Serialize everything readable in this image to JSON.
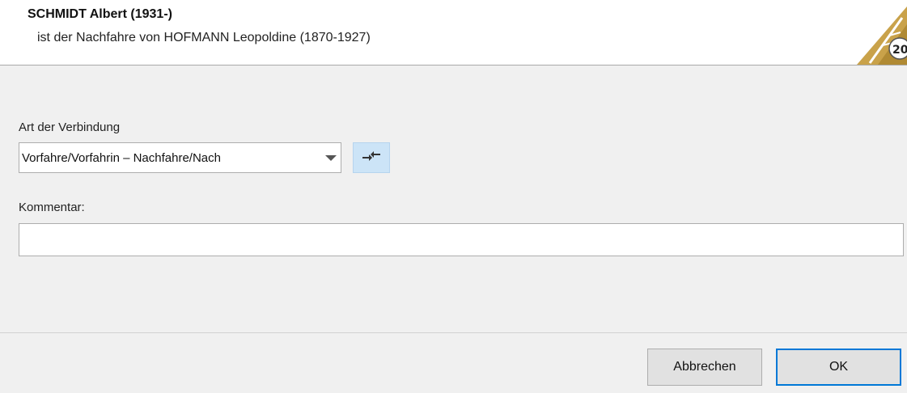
{
  "header": {
    "title": "SCHMIDT Albert (1931-)",
    "subtitle": "ist der Nachfahre von HOFMANN Leopoldine (1870-1927)",
    "logo_text": "20"
  },
  "form": {
    "connection_label": "Art der Verbindung",
    "connection_value": "Vorfahre/Vorfahrin – Nachfahre/Nach",
    "swap_icon": "swap-arrows-icon",
    "comment_label": "Kommentar:",
    "comment_value": ""
  },
  "footer": {
    "cancel_label": "Abbrechen",
    "ok_label": "OK"
  },
  "colors": {
    "accent": "#0078d7",
    "swap_bg": "#cce4f7",
    "logo_gold": "#c9a24a"
  }
}
